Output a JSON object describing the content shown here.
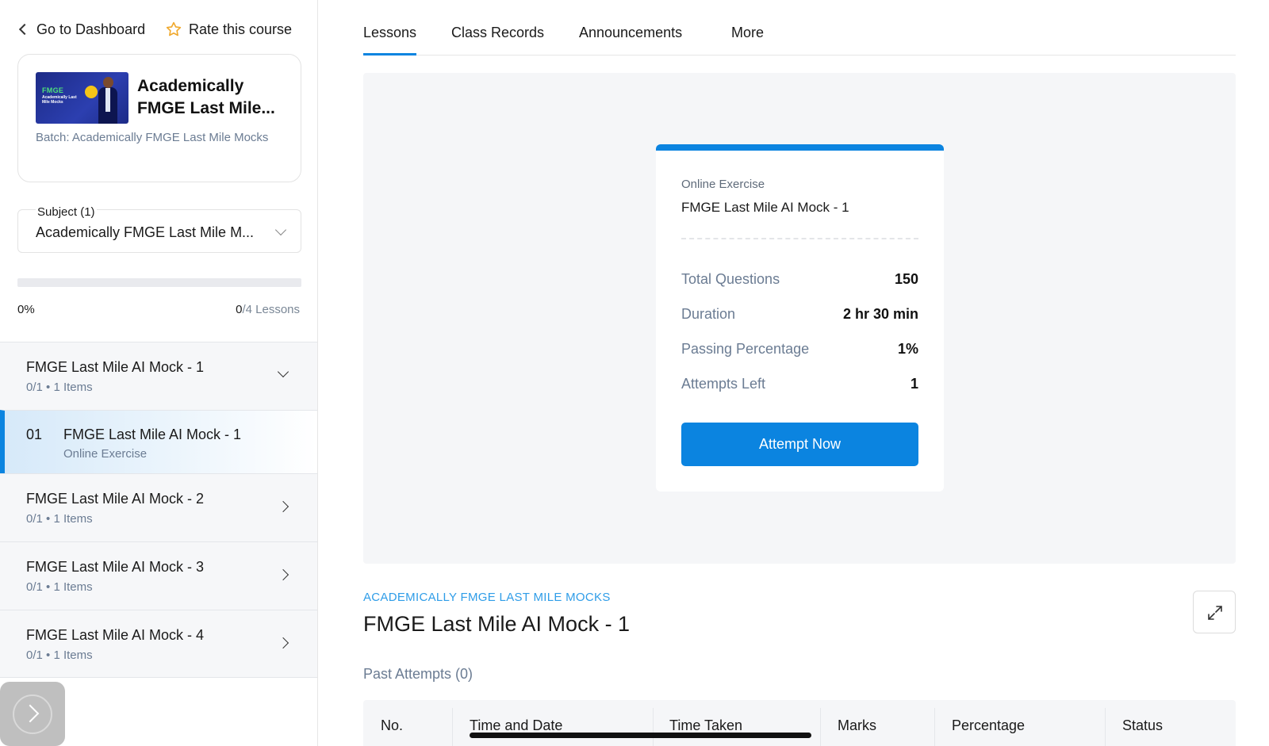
{
  "sidebar": {
    "back_label": "Go to Dashboard",
    "rate_label": "Rate this course",
    "course": {
      "title": "Academically FMGE Last Mile...",
      "batch": "Batch: Academically FMGE Last Mile Mocks",
      "thumb_text_1": "FMGE",
      "thumb_text_2": "Academically Last Mile Mocks"
    },
    "subject": {
      "label": "Subject (1)",
      "value": "Academically FMGE Last Mile M..."
    },
    "progress": {
      "percent": 0,
      "percent_label": "0%",
      "completed": "0",
      "total_label": "/4 Lessons"
    },
    "modules": [
      {
        "title": "FMGE Last Mile AI Mock - 1",
        "subtitle": "0/1 • 1 Items",
        "expanded": true
      },
      {
        "title": "FMGE Last Mile AI Mock - 2",
        "subtitle": "0/1 • 1 Items",
        "expanded": false
      },
      {
        "title": "FMGE Last Mile AI Mock - 3",
        "subtitle": "0/1 • 1 Items",
        "expanded": false
      },
      {
        "title": "FMGE Last Mile AI Mock - 4",
        "subtitle": "0/1 • 1 Items",
        "expanded": false
      }
    ],
    "active_lesson": {
      "number": "01",
      "title": "FMGE Last Mile AI Mock - 1",
      "type": "Online Exercise"
    }
  },
  "tabs": [
    {
      "label": "Lessons",
      "active": true
    },
    {
      "label": "Class Records",
      "active": false
    },
    {
      "label": "Announcements",
      "active": false
    },
    {
      "label": "More",
      "active": false
    }
  ],
  "exercise": {
    "type": "Online Exercise",
    "title": "FMGE Last Mile AI Mock - 1",
    "stats": [
      {
        "label": "Total Questions",
        "value": "150"
      },
      {
        "label": "Duration",
        "value": "2 hr 30 min"
      },
      {
        "label": "Passing Percentage",
        "value": "1%"
      },
      {
        "label": "Attempts Left",
        "value": "1"
      }
    ],
    "cta": "Attempt Now"
  },
  "lesson_header": {
    "breadcrumb": "ACADEMICALLY FMGE LAST MILE MOCKS",
    "title": "FMGE Last Mile AI Mock - 1"
  },
  "past_attempts": {
    "label": "Past Attempts (0)",
    "columns": [
      "No.",
      "Time and Date",
      "Time Taken",
      "Marks",
      "Percentage",
      "Status"
    ]
  },
  "icons": {
    "back": "chevron-left-icon",
    "rate": "star-icon",
    "expand": "expand-icon",
    "float": "chevron-right-icon"
  },
  "colors": {
    "accent": "#0b84e0",
    "star": "#f0a92e",
    "muted": "#6b7c93"
  }
}
